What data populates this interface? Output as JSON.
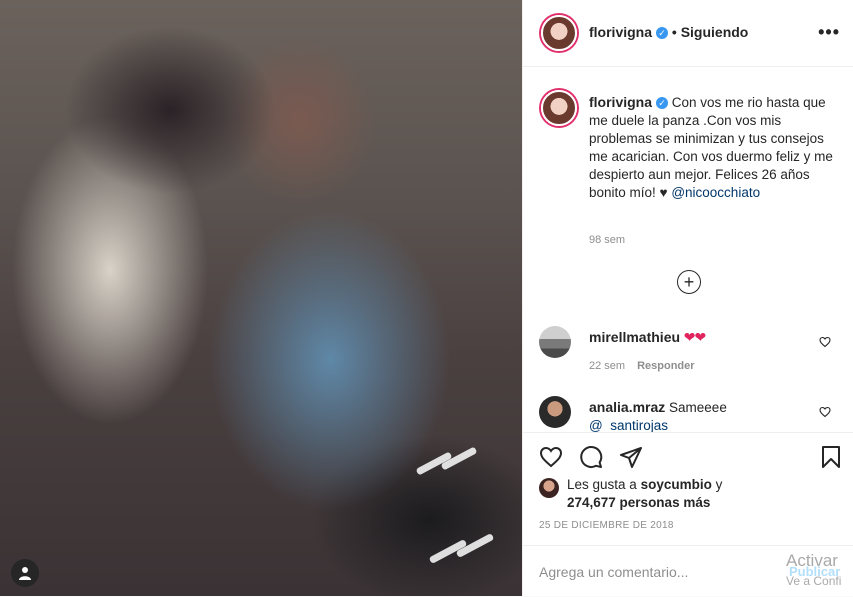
{
  "post": {
    "username": "florivigna",
    "verified_mark": "✓",
    "follow_status": "• Siguiendo",
    "more_icon": "more-options-icon"
  },
  "caption": {
    "username": "florivigna",
    "text": "Con vos me rio hasta que me duele la panza .Con vos mis problemas se minimizan y tus consejos me acarician. Con vos duermo feliz y me despierto aun mejor. Felices 26 años bonito mío! ♥",
    "mention": "@nicoocchiato",
    "time": "98 sem"
  },
  "comments": [
    {
      "username": "mirellmathieu",
      "text": "❤❤",
      "time": "22 sem",
      "reply_label": "Responder"
    },
    {
      "username": "analia.mraz",
      "text": "Sameeee",
      "mention": "@_santirojas"
    }
  ],
  "likes": {
    "text_prefix": "Les gusta a ",
    "user": "soycumbio",
    "text_mid": " y",
    "count_text": "274,677 personas más"
  },
  "date": "25 DE DICIEMBRE DE 2018",
  "add_comment": {
    "placeholder": "Agrega un comentario...",
    "publish_label": "Publicar"
  },
  "watermark": {
    "line1": "Activar",
    "line2": "Ve a Confi"
  },
  "colors": {
    "accent": "#3897f0",
    "link": "#00376b",
    "heart": "#e0245e"
  }
}
